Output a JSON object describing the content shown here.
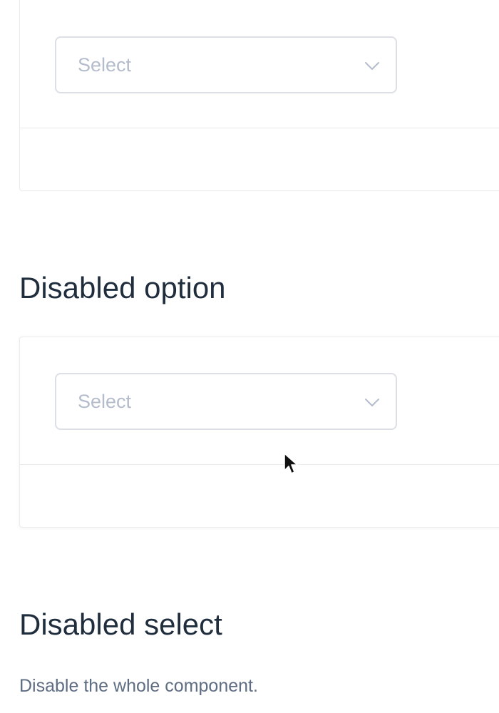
{
  "demos": [
    {
      "select": {
        "placeholder": "Select",
        "icon": "chevron-down-icon"
      }
    },
    {
      "select": {
        "placeholder": "Select",
        "icon": "chevron-down-icon"
      }
    }
  ],
  "sections": {
    "disabled_option": {
      "title": "Disabled option"
    },
    "disabled_select": {
      "title": "Disabled select",
      "description": "Disable the whole component."
    }
  },
  "colors": {
    "border": "#dcdfe6",
    "placeholder": "#b4bccc",
    "heading": "#1f2d3d",
    "description": "#5e6d82",
    "divider": "#ebebeb"
  }
}
